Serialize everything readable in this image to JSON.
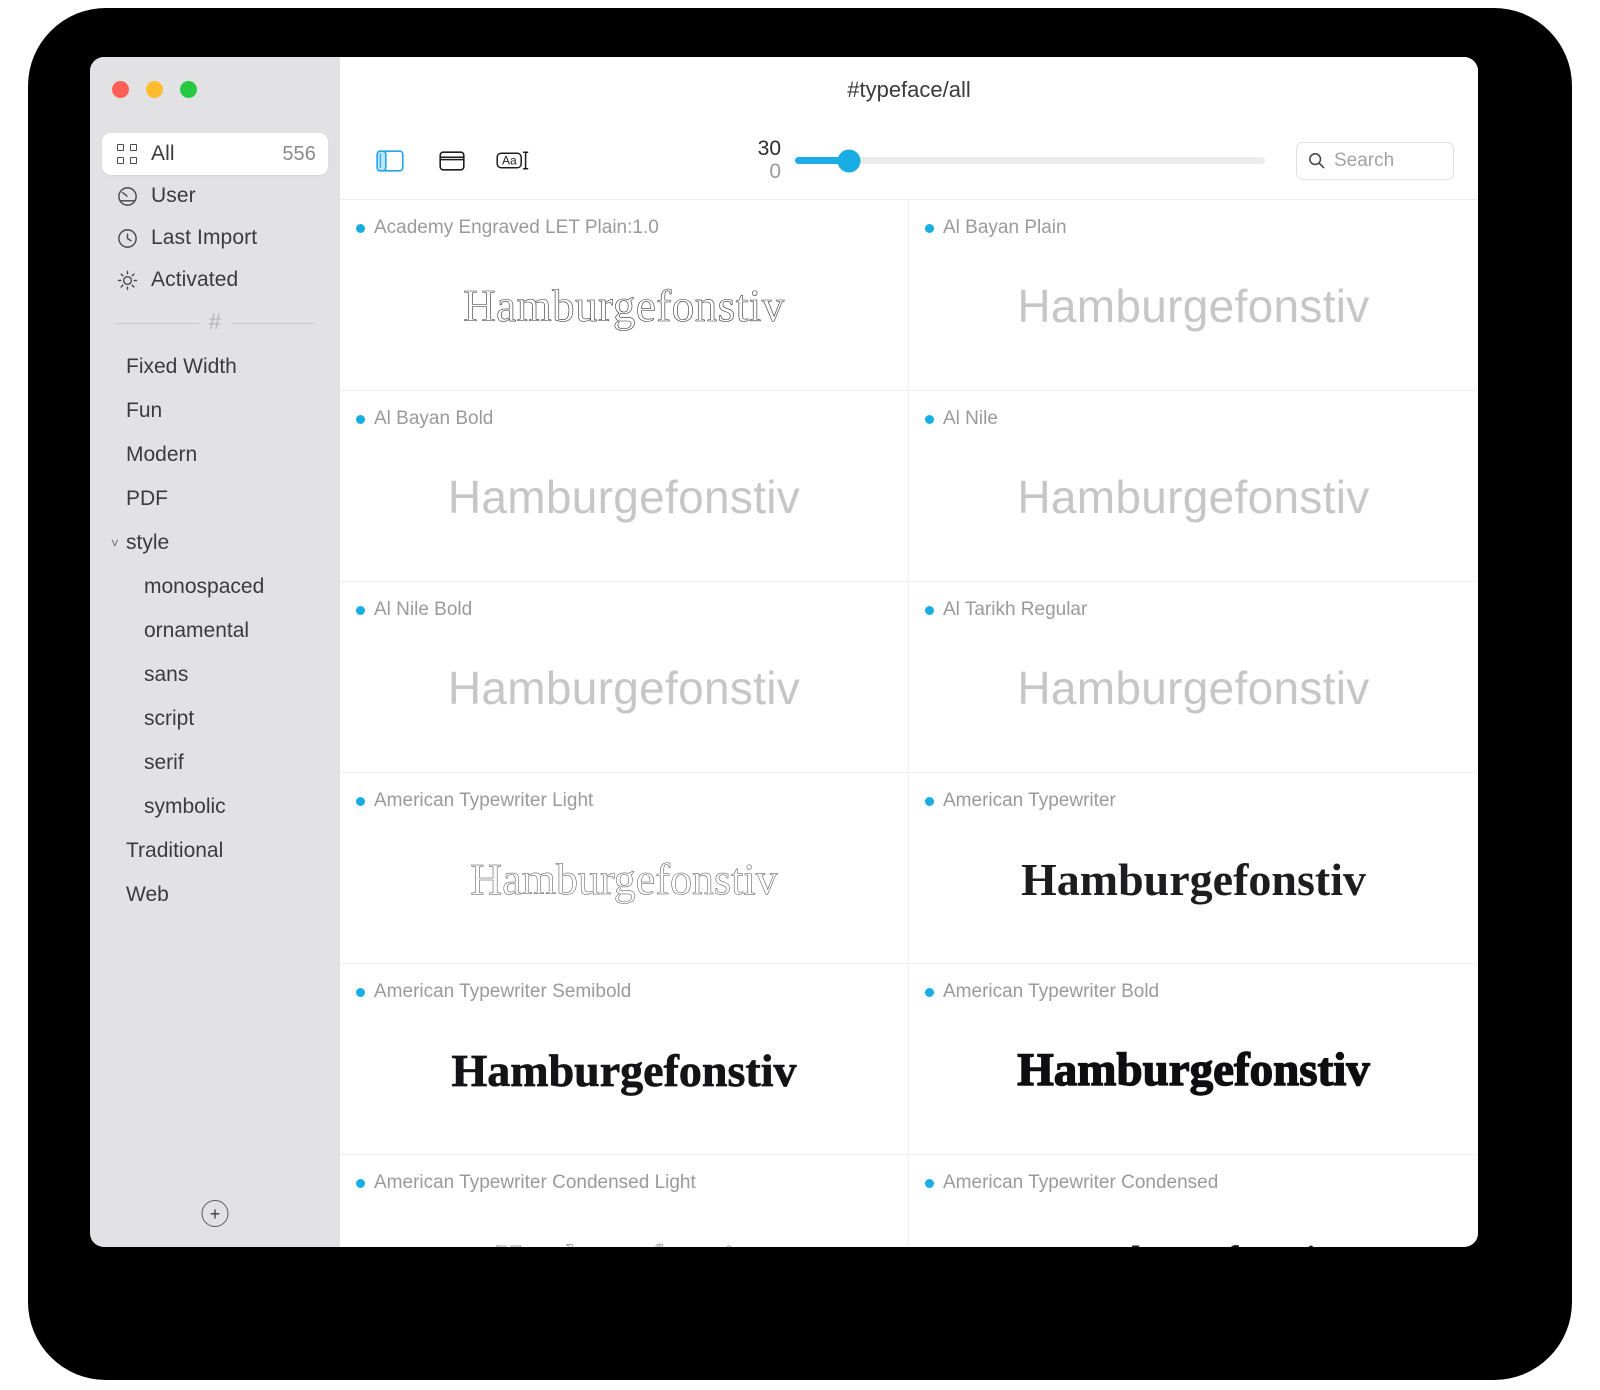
{
  "window": {
    "title": "#typeface/all",
    "traffic_lights": [
      "close",
      "minimize",
      "zoom"
    ]
  },
  "sidebar": {
    "smart_collections": [
      {
        "label": "All",
        "count": "556",
        "icon": "grid-icon",
        "selected": true
      },
      {
        "label": "User",
        "count": "",
        "icon": "user-circle-icon",
        "selected": false
      },
      {
        "label": "Last Import",
        "count": "",
        "icon": "clock-icon",
        "selected": false
      },
      {
        "label": "Activated",
        "count": "",
        "icon": "sun-icon",
        "selected": false
      }
    ],
    "divider_glyph": "#",
    "tags": [
      {
        "label": "Fixed Width",
        "child": false,
        "expandable": false
      },
      {
        "label": "Fun",
        "child": false,
        "expandable": false
      },
      {
        "label": "Modern",
        "child": false,
        "expandable": false
      },
      {
        "label": "PDF",
        "child": false,
        "expandable": false
      },
      {
        "label": "style",
        "child": false,
        "expandable": true,
        "chevron": "˅"
      },
      {
        "label": "monospaced",
        "child": true,
        "expandable": false
      },
      {
        "label": "ornamental",
        "child": true,
        "expandable": false
      },
      {
        "label": "sans",
        "child": true,
        "expandable": false
      },
      {
        "label": "script",
        "child": true,
        "expandable": false
      },
      {
        "label": "serif",
        "child": true,
        "expandable": false
      },
      {
        "label": "symbolic",
        "child": true,
        "expandable": false
      },
      {
        "label": "Traditional",
        "child": false,
        "expandable": false
      },
      {
        "label": "Web",
        "child": false,
        "expandable": false
      }
    ],
    "add_button_label": "+"
  },
  "toolbar": {
    "view_icons": [
      {
        "name": "sidebar-toggle-icon",
        "active": true
      },
      {
        "name": "card-view-icon",
        "active": false
      },
      {
        "name": "text-sample-icon",
        "active": false,
        "glyph": "Aa"
      }
    ],
    "slider": {
      "value_top": "30",
      "value_bottom": "0",
      "percent": 11.5
    },
    "search": {
      "placeholder": "Search",
      "value": "",
      "icon": "search-icon"
    }
  },
  "font_grid": {
    "sample_text": "Hamburgefonstiv",
    "accent_color": "#18ade4",
    "items": [
      {
        "name": "Academy Engraved LET Plain:1.0",
        "style": "s-engraved"
      },
      {
        "name": "Al Bayan Plain",
        "style": "s-thin-sans"
      },
      {
        "name": "Al Bayan Bold",
        "style": "s-thin-sans"
      },
      {
        "name": "Al Nile",
        "style": "s-thin-sans"
      },
      {
        "name": "Al Nile Bold",
        "style": "s-thin-sans"
      },
      {
        "name": "Al Tarikh Regular",
        "style": "s-thin-sans"
      },
      {
        "name": "American Typewriter Light",
        "style": "s-tw-light"
      },
      {
        "name": "American Typewriter",
        "style": "s-tw-reg"
      },
      {
        "name": "American Typewriter Semibold",
        "style": "s-tw-semi"
      },
      {
        "name": "American Typewriter Bold",
        "style": "s-tw-bold"
      },
      {
        "name": "American Typewriter Condensed Light",
        "style": "s-tw-cond-light"
      },
      {
        "name": "American Typewriter Condensed",
        "style": "s-tw-cond"
      }
    ]
  }
}
